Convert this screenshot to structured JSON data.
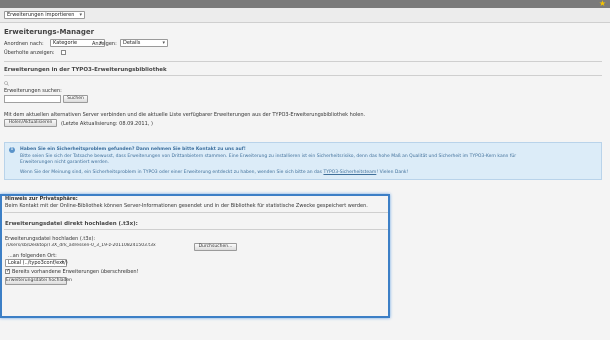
{
  "toolbar": {
    "menu_selected": "Erweiterungen importieren"
  },
  "page": {
    "title": "Erweiterungs-Manager"
  },
  "filters": {
    "sort_label": "Anordnen nach:",
    "sort_value": "Kategorie",
    "show_label": "Anzeigen:",
    "show_value": "Details",
    "obsolete_label": "Überholte anzeigen:"
  },
  "repository": {
    "heading": "Erweiterungen in der TYPO3-Erweiterungsbibliothek",
    "search_label": "Erweiterungen suchen:",
    "search_value": "",
    "search_button": "Suchen",
    "description": "Mit dem aktuellen alternativen Server verbinden und die aktuelle Liste verfügbarer Erweiterungen aus der TYPO3-Erweiterungsbibliothek holen.",
    "update_button": "Holen/Aktualisieren",
    "last_update": "(Letzte Aktualisierung: 08.09.2011, )"
  },
  "info": {
    "title": "Haben Sie ein Sicherheitsproblem gefunden? Dann nehmen Sie bitte Kontakt zu uns auf!",
    "line1": "Bitte seien Sie sich der Tatsache bewusst, dass Erweiterungen von Drittanbietern stammen. Eine Erweiterung zu installieren ist ein Sicherheitsrisiko, denn das hohe Maß an Qualität und Sicherheit im TYPO3-Kern kann für",
    "line2": "Erweiterungen nicht garantiert werden.",
    "line3_prefix": "Wenn Sie der Meinung sind, ein Sicherheitsproblem in TYPO3 oder einer Erweiterung entdeckt zu haben, wenden Sie sich bitte an das",
    "line3_link": "TYPO3-Sicherheitsteam",
    "line3_suffix": "! Vielen Dank!"
  },
  "privacy": {
    "title": "Hinweis zur Privatsphäre:",
    "text": "Beim Kontakt mit der Online-Bibliothek können Server-Informationen gesendet und in der Bibliothek für statistische Zwecke gespeichert werden."
  },
  "upload": {
    "heading": "Erweiterungsdatei direkt hochladen (.t3x):",
    "file_label": "Erweiterungsdatei hochladen (.t3x):",
    "file_value": "/Users/sb/Desktop/T3X_drk_adressen-0_3_19-z-201108241503.t3x",
    "browse_button": "Durchsuchen...",
    "location_label": "...an folgenden Ort:",
    "location_value": "Lokal (../typo3conf/ext/)",
    "overwrite_label": "Bereits vorhandene Erweiterungen überschreiben!",
    "overwrite_checked": true,
    "submit_button": "Erweiterungsdatei hochladen"
  }
}
